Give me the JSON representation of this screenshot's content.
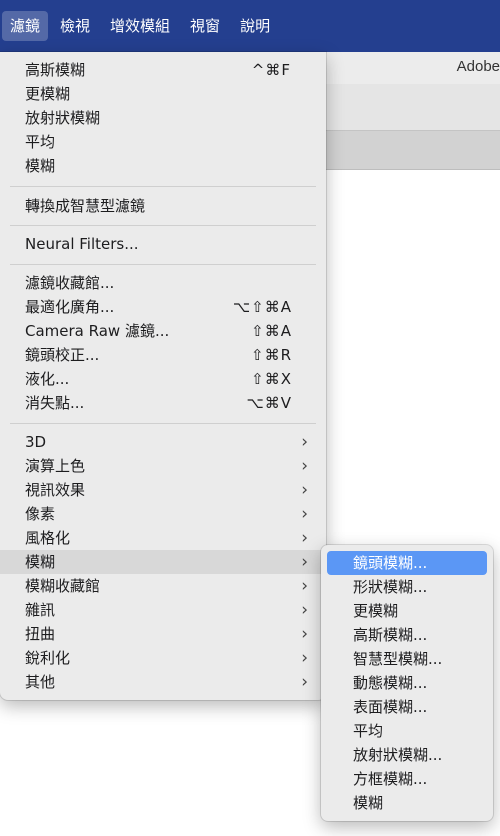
{
  "menubar": {
    "items": [
      {
        "label": "濾鏡",
        "active": true
      },
      {
        "label": "檢視"
      },
      {
        "label": "增效模組"
      },
      {
        "label": "視窗"
      },
      {
        "label": "說明"
      }
    ]
  },
  "background": {
    "adobe_label": "Adobe"
  },
  "filter_menu": {
    "items": [
      {
        "label": "高斯模糊",
        "shortcut": "^⌘F"
      },
      {
        "label": "更模糊"
      },
      {
        "label": "放射狀模糊"
      },
      {
        "label": "平均"
      },
      {
        "label": "模糊"
      },
      {
        "label": "轉換成智慧型濾鏡"
      },
      {
        "label": "Neural Filters..."
      },
      {
        "label": "濾鏡收藏館..."
      },
      {
        "label": "最適化廣角...",
        "shortcut": "⌥⇧⌘A"
      },
      {
        "label": "Camera Raw 濾鏡...",
        "shortcut": "⇧⌘A"
      },
      {
        "label": "鏡頭校正...",
        "shortcut": "⇧⌘R"
      },
      {
        "label": "液化...",
        "shortcut": "⇧⌘X"
      },
      {
        "label": "消失點...",
        "shortcut": "⌥⌘V"
      },
      {
        "label": "3D",
        "submenu": true
      },
      {
        "label": "演算上色",
        "submenu": true
      },
      {
        "label": "視訊效果",
        "submenu": true
      },
      {
        "label": "像素",
        "submenu": true
      },
      {
        "label": "風格化",
        "submenu": true
      },
      {
        "label": "模糊",
        "submenu": true,
        "hover": true
      },
      {
        "label": "模糊收藏館",
        "submenu": true
      },
      {
        "label": "雜訊",
        "submenu": true
      },
      {
        "label": "扭曲",
        "submenu": true
      },
      {
        "label": "銳利化",
        "submenu": true
      },
      {
        "label": "其他",
        "submenu": true
      }
    ],
    "chevron_icon": "chevron-right-icon"
  },
  "blur_submenu": {
    "items": [
      {
        "label": "鏡頭模糊...",
        "selected": true
      },
      {
        "label": "形狀模糊..."
      },
      {
        "label": "更模糊"
      },
      {
        "label": "高斯模糊..."
      },
      {
        "label": "智慧型模糊..."
      },
      {
        "label": "動態模糊..."
      },
      {
        "label": "表面模糊..."
      },
      {
        "label": "平均"
      },
      {
        "label": "放射狀模糊..."
      },
      {
        "label": "方框模糊..."
      },
      {
        "label": "模糊"
      }
    ]
  },
  "colors": {
    "menubar_bg": "#243f8f",
    "menu_bg": "#ebebeb",
    "selection": "#5b97f5",
    "hover": "#d8d8d8"
  }
}
